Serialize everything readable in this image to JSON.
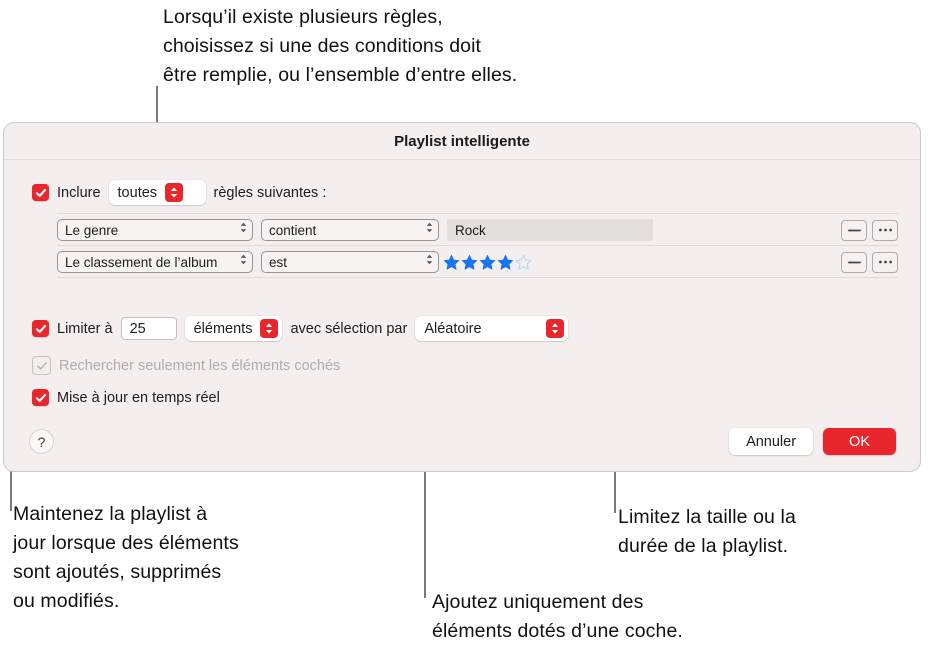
{
  "annotations": {
    "top": "Lorsqu’il existe plusieurs règles,\nchoisissez si une des conditions doit\nêtre remplie, ou l’ensemble d’entre elles.",
    "bottom_left": "Maintenez la playlist à\njour lorsque des éléments\nsont ajoutés, supprimés\nou modifiés.",
    "bottom_middle": "Ajoutez uniquement des\néléments dotés d’une coche.",
    "bottom_right": "Limitez la taille ou la\ndurée de la playlist."
  },
  "dialog": {
    "title": "Playlist intelligente",
    "include": {
      "checkbox_checked": true,
      "prefix_label": "Inclure",
      "match_value": "toutes",
      "suffix_label": "règles suivantes :"
    },
    "rules": [
      {
        "field": "Le genre",
        "operator": "contient",
        "value": "Rock",
        "value_type": "text",
        "remove_label": "—",
        "more_label": "•••"
      },
      {
        "field": "Le classement de l’album",
        "operator": "est",
        "value": "",
        "value_type": "rating",
        "rating_filled": 4,
        "rating_total": 5,
        "remove_label": "—",
        "more_label": "•••"
      }
    ],
    "limit": {
      "checkbox_checked": true,
      "label": "Limiter à",
      "amount": "25",
      "unit": "éléments",
      "selection_label": "avec sélection par",
      "selection_value": "Aléatoire"
    },
    "checked_only": {
      "checkbox_checked": true,
      "enabled": false,
      "label": "Rechercher seulement les éléments cochés"
    },
    "live_update": {
      "checkbox_checked": true,
      "label": "Mise à jour en temps réel"
    },
    "footer": {
      "help_label": "?",
      "cancel_label": "Annuler",
      "ok_label": "OK"
    }
  },
  "colors": {
    "accent_red": "#e8262b",
    "dialog_background": "#f4eeee",
    "star_blue": "#1874f0",
    "leader_gray": "#7b7b7b"
  }
}
